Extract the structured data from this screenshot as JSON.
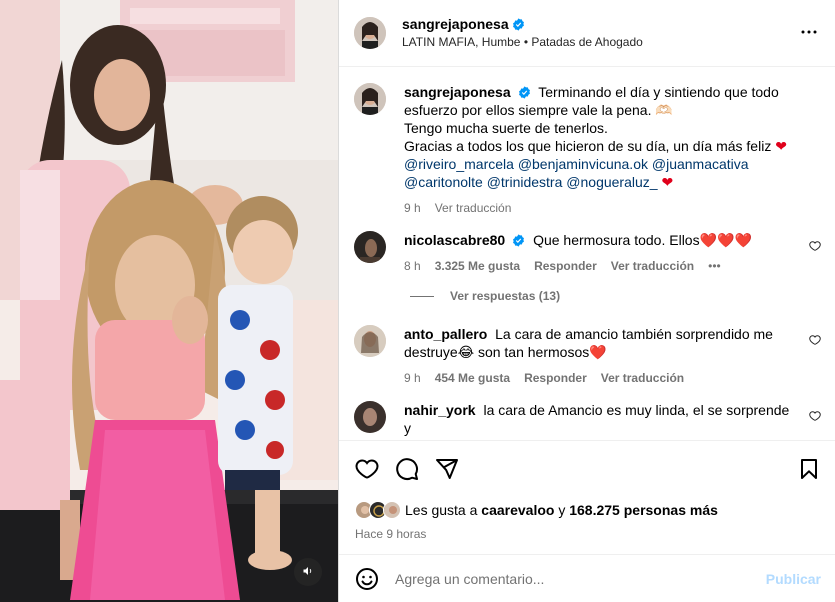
{
  "header": {
    "username": "sangrejaponesa",
    "subtitle_location": "LATIN MAFIA, Humbe",
    "subtitle_separator": "•",
    "subtitle_audio": "Patadas de Ahogado"
  },
  "caption": {
    "username": "sangrejaponesa",
    "line1": "Terminando el día y sintiendo que todo esfuerzo por ellos siempre vale la pena. 🫶🏻",
    "line2": "Tengo mucha suerte de tenerlos.",
    "line3": "Gracias a todos los que hicieron de su día, un día más feliz",
    "heart": "❤",
    "mentions": [
      "@riveiro_marcela",
      "@benjaminvicuna.ok",
      "@juanmacativa",
      "@caritonolte",
      "@trinidestra",
      "@nogueraluz_"
    ],
    "time": "9 h",
    "translate": "Ver traducción"
  },
  "comments": [
    {
      "username": "nicolascabre80",
      "verified": true,
      "text": "Que hermosura todo. Ellos",
      "hearts": "❤️❤️❤️",
      "time": "8 h",
      "likes": "3.325 Me gusta",
      "reply": "Responder",
      "translate": "Ver traducción",
      "more": "•••",
      "view_replies": "Ver respuestas (13)"
    },
    {
      "username": "anto_pallero",
      "text": "La cara de amancio también sorprendido me destruye😂 son tan hermosos❤️",
      "time": "9 h",
      "likes": "454 Me gusta",
      "reply": "Responder",
      "translate": "Ver traducción"
    },
    {
      "username": "nahir_york",
      "text": "la cara de Amancio es muy linda, el se sorprende y"
    }
  ],
  "likes": {
    "prefix": "Les gusta a",
    "user": "caarevaloo",
    "connector": "y",
    "count": "168.275 personas más"
  },
  "timestamp": "Hace 9 horas",
  "add_comment": {
    "placeholder": "Agrega un comentario...",
    "post_label": "Publicar"
  },
  "colors": {
    "verified_blue": "#0095f6",
    "mention_blue": "#00376b",
    "heart_red": "#e0001b",
    "post_button_disabled": "#b3dbff",
    "muted_text": "#737373"
  },
  "icons": [
    "more-icon",
    "verified-icon",
    "like-icon",
    "comment-icon",
    "share-icon",
    "save-icon",
    "emoji-icon",
    "volume-icon"
  ]
}
